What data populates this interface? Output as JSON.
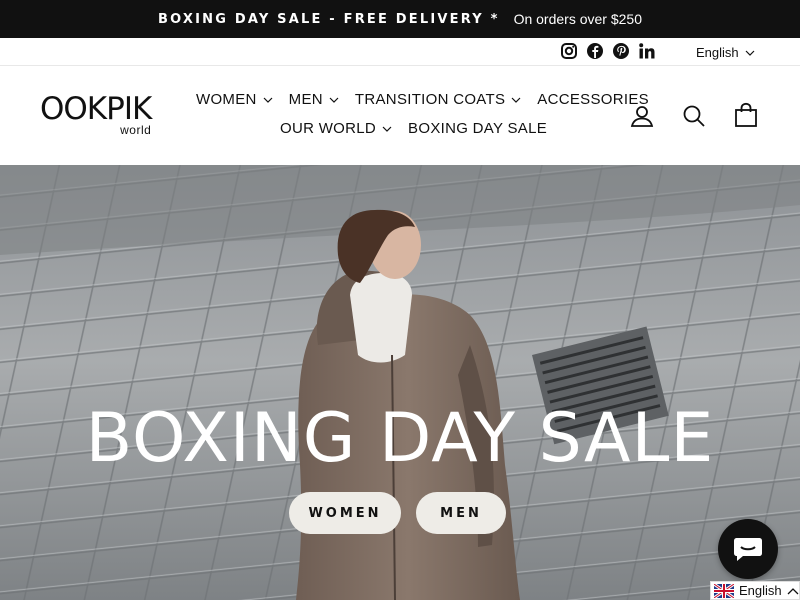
{
  "announcement": {
    "promo": "BOXING DAY SALE - FREE DELIVERY *",
    "subtext": "On orders over $250"
  },
  "utility": {
    "social_icons": [
      "instagram-icon",
      "facebook-icon",
      "pinterest-icon",
      "linkedin-icon"
    ],
    "language": "English"
  },
  "header": {
    "logo_text": "OOKPIK",
    "logo_sub": "world",
    "nav_row1": [
      {
        "label": "WOMEN",
        "has_dropdown": true
      },
      {
        "label": "MEN",
        "has_dropdown": true
      },
      {
        "label": "TRANSITION COATS",
        "has_dropdown": true
      },
      {
        "label": "ACCESSORIES",
        "has_dropdown": false
      }
    ],
    "nav_row2": [
      {
        "label": "OUR WORLD",
        "has_dropdown": true
      },
      {
        "label": "BOXING DAY SALE",
        "has_dropdown": false
      }
    ],
    "icons": [
      "account-icon",
      "search-icon",
      "cart-icon"
    ]
  },
  "hero": {
    "title": "BOXING DAY SALE",
    "buttons": [
      {
        "label": "WOMEN"
      },
      {
        "label": "MEN"
      }
    ]
  },
  "lang_widget": {
    "label": "English"
  },
  "colors": {
    "announce_bg": "#111111",
    "button_bg": "#eeece7",
    "chat_bg": "#111111"
  }
}
